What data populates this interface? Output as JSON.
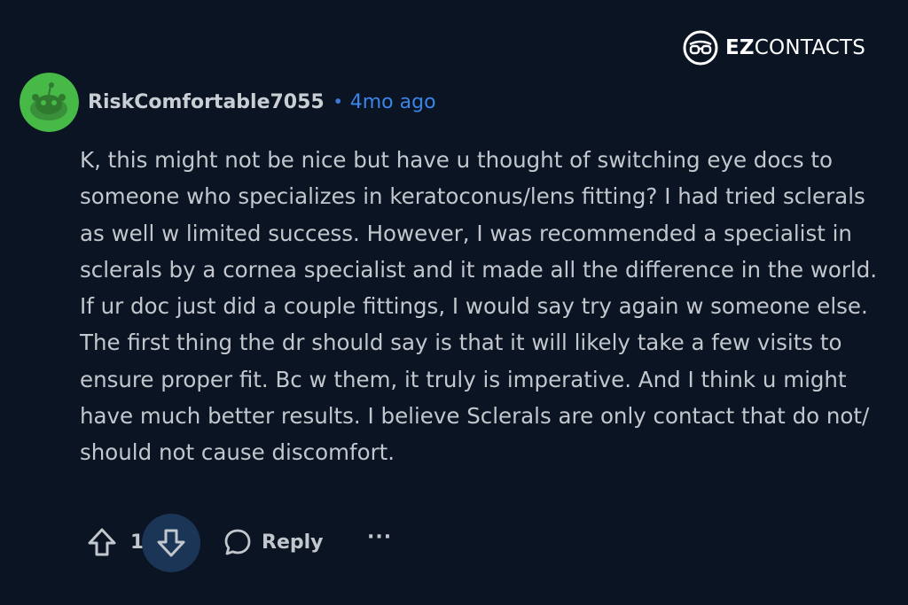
{
  "brand": {
    "name_bold": "EZ",
    "name_rest": "CONTACTS",
    "logo_icon": "ez-glasses-logo"
  },
  "comment": {
    "username": "RiskComfortable7055",
    "separator": "•",
    "timestamp": "4mo ago",
    "avatar_icon": "reddit-snoo-avatar",
    "text": "K, this might not be nice but have u thought of switching eye docs to someone who specializes in keratoconus/lens fitting? I had tried sclerals as well w limited success. However, I was recommended a specialist in sclerals by a cornea specialist and it made all the difference in the world. If ur doc just did a couple fittings, I would say try again w someone else. The first thing the dr should say is that it will likely take a few visits to ensure proper fit. Bc w them, it truly is imperative. And I think u might have much better results. I believe Sclerals are only contact that do not/ should not cause discomfort."
  },
  "actions": {
    "score": "1",
    "reply_label": "Reply",
    "more_label": "···"
  },
  "colors": {
    "background": "#0b1422",
    "accent_blue": "#3d84e8",
    "avatar_green": "#46b946",
    "downvote_bg": "#1a3556"
  }
}
